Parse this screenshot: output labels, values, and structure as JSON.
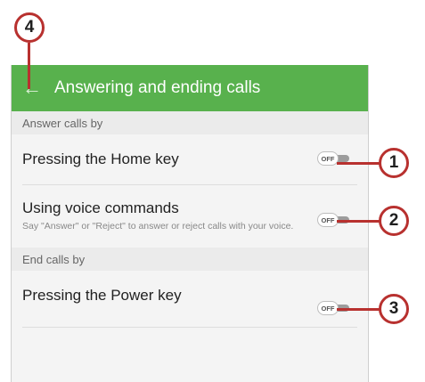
{
  "appbar": {
    "title": "Answering and ending calls",
    "back_icon": "arrow-left-icon"
  },
  "sections": {
    "answer": {
      "header": "Answer calls by"
    },
    "end": {
      "header": "End calls by"
    }
  },
  "rows": {
    "home_key": {
      "title": "Pressing the Home key",
      "toggle": "OFF"
    },
    "voice": {
      "title": "Using voice commands",
      "description": "Say \"Answer\" or \"Reject\" to answer or reject calls with your voice.",
      "toggle": "OFF"
    },
    "power_key": {
      "title": "Pressing the Power key",
      "toggle": "OFF"
    }
  },
  "callouts": {
    "c1": "1",
    "c2": "2",
    "c3": "3",
    "c4": "4"
  },
  "colors": {
    "appbar": "#58b14d",
    "callout": "#b8312f",
    "toggle_track": "#9c9c9c"
  }
}
